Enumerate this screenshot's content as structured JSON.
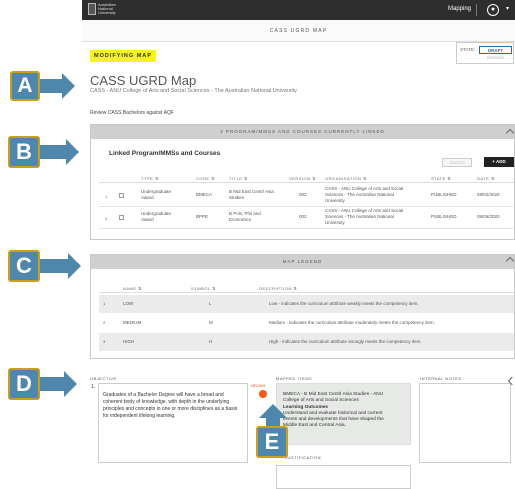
{
  "topbar": {
    "logo_text": [
      "Australian",
      "National",
      "University"
    ],
    "mapping_label": "Mapping",
    "user_icon": "user-circle-icon",
    "caret_icon": "chevron-down-icon"
  },
  "subbar": {
    "title": "CASS UGRD MAP"
  },
  "banner": {
    "modifying": "MODIFYING MAP"
  },
  "state": {
    "label": "STATE:",
    "value": "DRAFT",
    "revision": "REVISION"
  },
  "page": {
    "title": "CASS UGRD Map",
    "subtitle": "CASS - ANU College of Arts and Social Sciences - The Australian National University",
    "review_link": "Review CASS Bachelors against AQF"
  },
  "linked": {
    "header": "2 PROGRAM/MMSS AND COURSES CURRENTLY LINKED",
    "title": "Linked Program/MMSs and Courses",
    "delete_label": "DELETE",
    "add_label": "+ ADD",
    "columns": {
      "type": "TYPE ⇅",
      "code": "CODE ⇅",
      "title": "TITLE ⇅",
      "version": "VERSION ⇅",
      "organisation": "ORGANISATION ⇅",
      "state": "STATE ⇅",
      "date": "DATE ⇅"
    },
    "rows": [
      {
        "num": "1",
        "type_l1": "Undergraduate",
        "type_l2": "Award",
        "code": "BMECA",
        "title_l1": "B Mid East Centrl Asia",
        "title_l2": "Studies",
        "version": "002",
        "org_l1": "CASS - ANU College of Arts and Social",
        "org_l2": "Sciences - The Australian National",
        "org_l3": "University",
        "state": "PUBLISHED",
        "date": "28/02/2020"
      },
      {
        "num": "2",
        "type_l1": "Undergraduate",
        "type_l2": "Award",
        "code": "BPPE",
        "title_l1": "B Pols, Phil and",
        "title_l2": "Economics",
        "version": "002",
        "org_l1": "CASS - ANU College of Arts and Social",
        "org_l2": "Sciences - The Australian National",
        "org_l3": "University",
        "state": "PUBLISHED",
        "date": "05/05/2020"
      }
    ]
  },
  "legend": {
    "header": "MAP LEGEND",
    "columns": {
      "name": "NAME ⇅",
      "symbol": "SYMBOL ⇅",
      "description": "DESCRIPTION ⇅"
    },
    "rows": [
      {
        "num": "1",
        "name": "LOW",
        "symbol": "L",
        "description": "Low - indicates the curriculum attribute weakly meets the competency item."
      },
      {
        "num": "2",
        "name": "MEDIUM",
        "symbol": "M",
        "description": "Medium - indicates the curriculum attribute moderately meets the competency item."
      },
      {
        "num": "3",
        "name": "HIGH",
        "symbol": "H",
        "description": "High - indicates the curriculum attribute strongly meets the competency item."
      }
    ]
  },
  "objective": {
    "label": "OBJECTIVE",
    "number": "1.",
    "text": "Graduates of a Bachelor Degree will have a broad and coherent body of knowledge, with depth in the underlying principles and concepts in one or more disciplines as a basis for independent lifelong learning."
  },
  "mapping_dot_label": "MEDIUM",
  "mapped": {
    "label": "MAPPED ITEMS",
    "line1": "BMECA - B Mid East Centrl Asia Studies - ANU",
    "line2": "College of Arts and Social Sciences",
    "heading": "Learning Outcomes",
    "line3": "Understand and evaluate historical and current",
    "line4": "events and developments that have shaped the",
    "line5": "Middle East and Central Asia."
  },
  "justification": {
    "label": "JUSTIFICATION"
  },
  "notes": {
    "label": "INTERNAL NOTES"
  },
  "callouts": {
    "a": "A",
    "b": "B",
    "c": "C",
    "d": "D",
    "e": "E"
  },
  "colors": {
    "callout_fill": "#4f86ac",
    "callout_border": "#c6a020",
    "draft": "#2a6ba8",
    "modifying_bg": "#f7f12a",
    "mapping_dot": "#f05a14"
  }
}
